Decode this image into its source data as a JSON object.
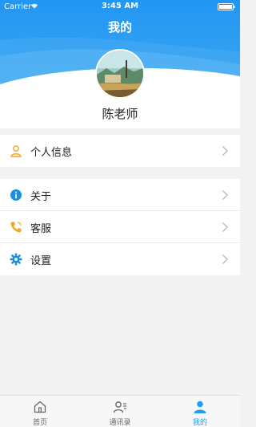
{
  "status_bar": {
    "carrier": "Carrier",
    "time": "3:45 AM"
  },
  "header": {
    "title": "我的"
  },
  "profile": {
    "name": "陈老师"
  },
  "menu_group_1": [
    {
      "label": "个人信息",
      "icon": "person-outline-icon"
    }
  ],
  "menu_group_2": [
    {
      "label": "关于",
      "icon": "info-icon"
    },
    {
      "label": "客服",
      "icon": "phone-icon"
    },
    {
      "label": "设置",
      "icon": "gear-icon"
    }
  ],
  "tabbar": {
    "items": [
      {
        "label": "首页",
        "icon": "home-icon",
        "active": false
      },
      {
        "label": "通讯录",
        "icon": "contacts-icon",
        "active": false
      },
      {
        "label": "我的",
        "icon": "user-icon",
        "active": true
      }
    ]
  },
  "colors": {
    "accent": "#1aa0f0",
    "header_blue": "#2b98f0",
    "orange": "#f5a623"
  }
}
